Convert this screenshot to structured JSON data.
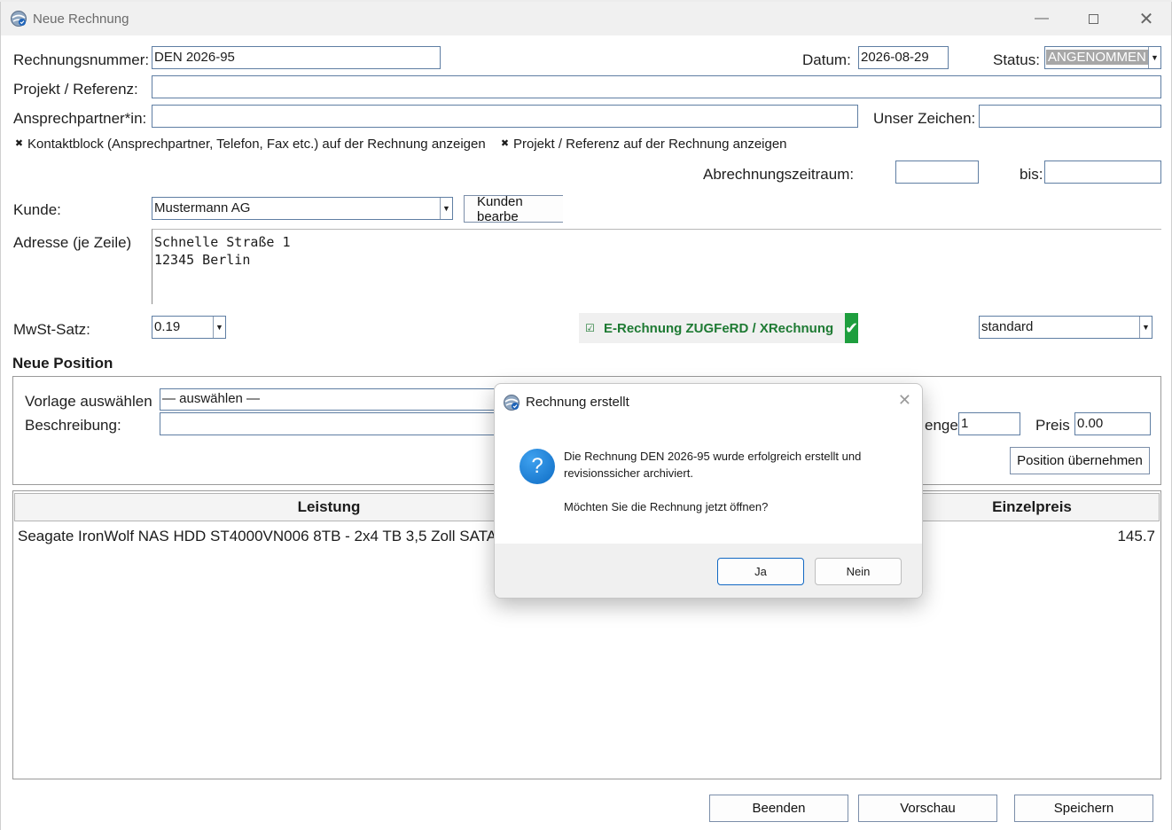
{
  "window": {
    "title": "Neue Rechnung"
  },
  "form": {
    "invoice_number_label": "Rechnungsnummer:",
    "invoice_number": "DEN 2026-95",
    "date_label": "Datum:",
    "date": "2026-08-29",
    "status_label": "Status:",
    "status": "ANGENOMMEN",
    "project_label": "Projekt / Referenz:",
    "project": "",
    "contact_label": "Ansprechpartner*in:",
    "contact": "",
    "our_ref_label": "Unser Zeichen:",
    "our_ref": "",
    "chk_contact_block": "Kontaktblock (Ansprechpartner, Telefon, Fax etc.) auf der Rechnung anzeigen",
    "chk_project_ref": "Projekt / Referenz auf der Rechnung anzeigen",
    "billing_period_label": "Abrechnungszeitraum:",
    "billing_from": "",
    "until_label": "bis:",
    "billing_to": "",
    "customer_label": "Kunde:",
    "customer": "Mustermann AG",
    "edit_customer_button": "Kunden bearbe",
    "address_label": "Adresse (je Zeile)",
    "address_line1": "Schnelle Straße 1",
    "address_line2": "12345 Berlin",
    "vat_label": "MwSt-Satz:",
    "vat": "0.19",
    "einvoice_label": "E-Rechnung ZUGFeRD / XRechnung",
    "einvoice_profile": "standard"
  },
  "new_position": {
    "section_title": "Neue Position",
    "template_label": "Vorlage auswählen",
    "template_value": "— auswählen —",
    "description_label": "Beschreibung:",
    "quantity_label_visible": "enge",
    "quantity": "1",
    "price_label": "Preis",
    "price": "0.00",
    "add_button": "Position übernehmen"
  },
  "table": {
    "headers": [
      "Leistung",
      "Einzelpreis"
    ],
    "rows": [
      {
        "service": "Seagate IronWolf NAS HDD ST4000VN006 8TB - 2x4 TB 3,5 Zoll SATA 6",
        "unit_price": "145.7"
      }
    ]
  },
  "footer": {
    "exit_button": "Beenden",
    "preview_button": "Vorschau",
    "save_button": "Speichern"
  },
  "dialog": {
    "title": "Rechnung erstellt",
    "message_line1": "Die Rechnung DEN 2026-95 wurde erfolgreich erstellt und",
    "message_line2": "revisionssicher archiviert.",
    "question": "Möchten Sie die Rechnung jetzt öffnen?",
    "yes_button": "Ja",
    "no_button": "Nein",
    "icon": "question-icon"
  },
  "colors": {
    "einvoice_green": "#1e9e3e",
    "status_highlight": "#a7a7a7",
    "accent_blue": "#1167c2"
  }
}
